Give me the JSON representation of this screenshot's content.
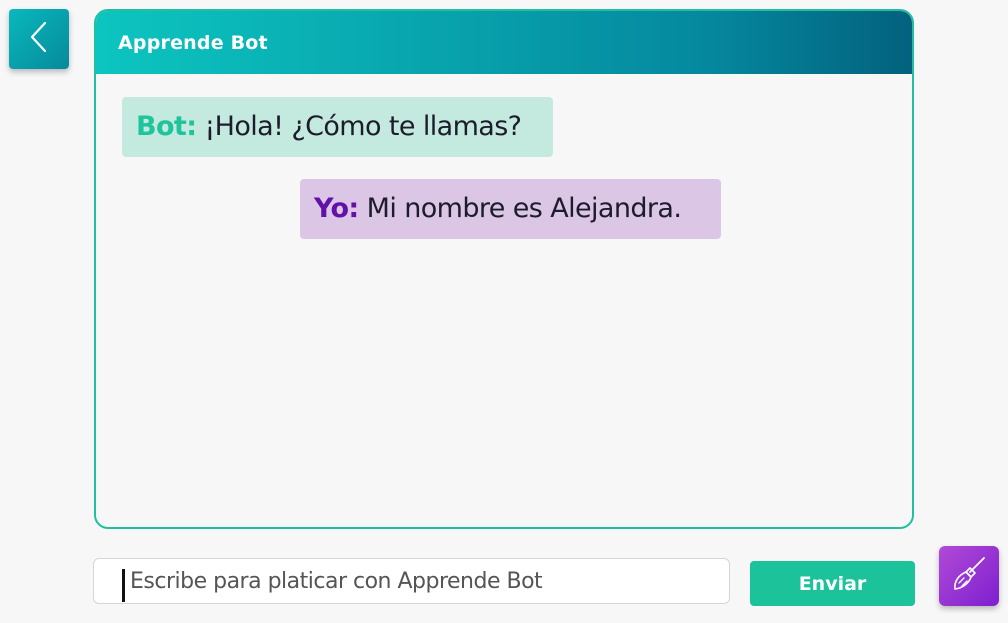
{
  "header": {
    "title": "Apprende Bot"
  },
  "messages": [
    {
      "speaker": "Bot:",
      "text": "¡Hola! ¿Cómo te llamas?"
    },
    {
      "speaker": "Yo:",
      "text": "Mi nombre es Alejandra."
    }
  ],
  "input": {
    "placeholder": "Escribe para platicar con Apprende Bot",
    "value": ""
  },
  "send_button": {
    "label": "Enviar"
  },
  "icons": {
    "back": "chevron-left-icon",
    "clear": "broom-icon"
  },
  "colors": {
    "header_start": "#0cc5c0",
    "header_end": "#03617e",
    "accent_green": "#1bc29a",
    "bot_bubble": "#c4eadf",
    "user_bubble": "#dbc6e5",
    "bot_speaker": "#1fc39c",
    "user_speaker": "#6312a8",
    "clear_button": "#9b32d4"
  }
}
